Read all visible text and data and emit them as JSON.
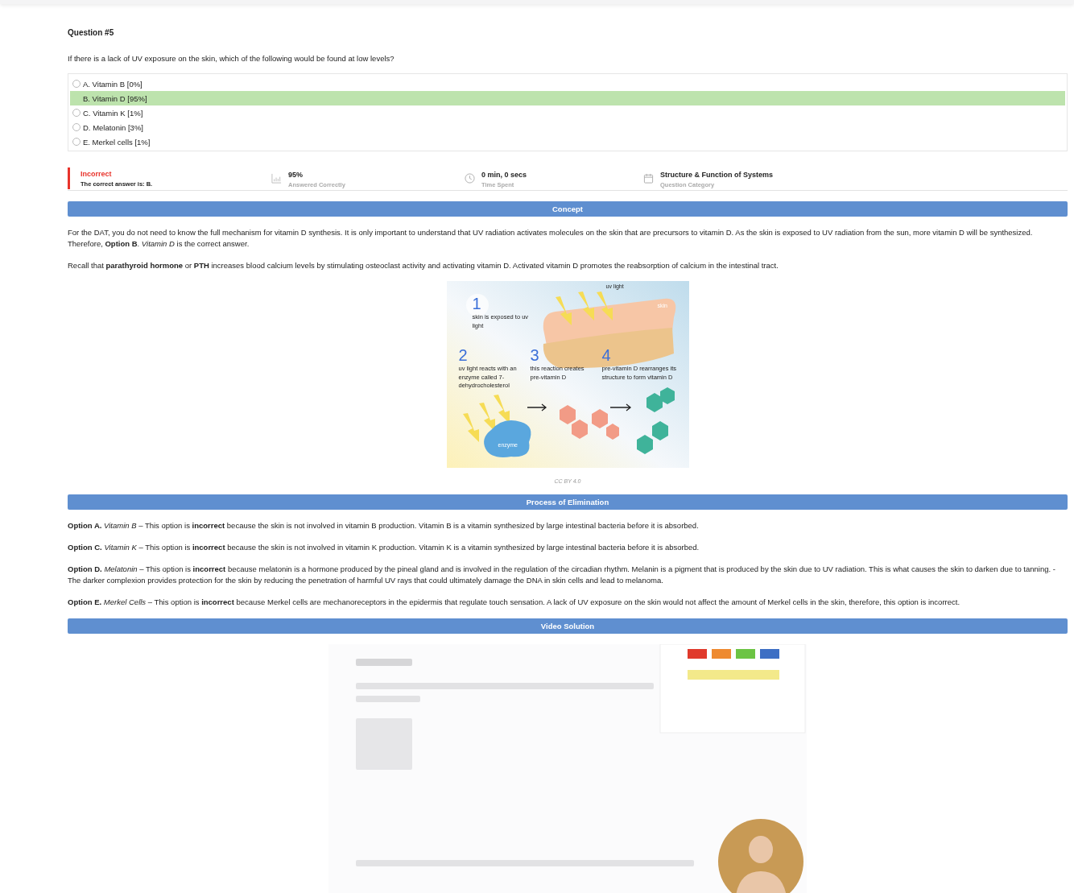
{
  "question": {
    "title": "Question #5",
    "text": "If there is a lack of UV exposure on the skin, which of the following would be found at low levels?",
    "options": [
      {
        "label": "A. Vitamin B [0%]",
        "correct": false
      },
      {
        "label": "B. Vitamin D [95%]",
        "correct": true
      },
      {
        "label": "C. Vitamin K [1%]",
        "correct": false
      },
      {
        "label": "D. Melatonin [3%]",
        "correct": false
      },
      {
        "label": "E. Merkel cells [1%]",
        "correct": false
      }
    ]
  },
  "result": {
    "correct": false,
    "status": "Incorrect",
    "note": "The correct answer is: B."
  },
  "stats": [
    {
      "kind": "percent",
      "value": "95%",
      "label": "Answered Correctly"
    },
    {
      "kind": "time",
      "value": "0 min, 0 secs",
      "label": "Time Spent"
    },
    {
      "kind": "category",
      "value": "Structure & Function of Systems",
      "label": "Question Category"
    }
  ],
  "concept": {
    "heading": "Concept",
    "paragraphs": [
      "For the DAT, you do not need to know the full mechanism for vitamin D synthesis. It is only important to understand that UV radiation activates molecules on the skin that are precursors to vitamin D. As the skin is exposed to UV radiation from the sun, more vitamin D will be synthesized. Therefore, **Option B**. *Vitamin D* is the correct answer.",
      "Recall that **parathyroid hormone** or **PTH** increases blood calcium levels by stimulating osteoclast activity and activating vitamin D. Activated vitamin D promotes the reabsorption of calcium in the intestinal tract."
    ],
    "figure": {
      "top_label": "uv light",
      "skin_label": "skin",
      "enzyme_label": "enzyme",
      "steps": [
        {
          "number": "1",
          "text": "skin is exposed to uv light"
        },
        {
          "number": "2",
          "text": "uv light reacts with an enzyme called 7-dehydrocholesterol"
        },
        {
          "number": "3",
          "text": "this reaction creates pre-vitamin D"
        },
        {
          "number": "4",
          "text": "pre-vitamin D rearranges its structure to form vitamin D"
        }
      ]
    },
    "caption": "CC BY 4.0"
  },
  "elimination": {
    "heading": "Process of Elimination",
    "paragraphs": [
      "**Option A.** *Vitamin B* – This option is **incorrect** because the skin is not involved in vitamin B production. Vitamin B is a vitamin synthesized by large intestinal bacteria before it is absorbed.",
      "**Option C.** *Vitamin K* – This option is **incorrect** because the skin is not involved in vitamin K production. Vitamin K is a vitamin synthesized by large intestinal bacteria before it is absorbed.",
      "**Option D.** *Melatonin* – This option is **incorrect** because melatonin is a hormone produced by the pineal gland and is involved in the regulation of the circadian rhythm. Melanin is a pigment that is produced by the skin due to UV radiation. This is what causes the skin to darken due to tanning. -The darker complexion provides protection for the skin by reducing the penetration of harmful UV rays that could ultimately damage the DNA in skin cells and lead to melanoma.",
      "**Option E.** *Merkel Cells* – This option is **incorrect** because Merkel cells are mechanoreceptors in the epidermis that regulate touch sensation. A lack of UV exposure on the skin would not affect the amount of Merkel cells in the skin, therefore, this option is incorrect."
    ]
  },
  "video": {
    "heading": "Video Solution",
    "kind": "picture"
  }
}
